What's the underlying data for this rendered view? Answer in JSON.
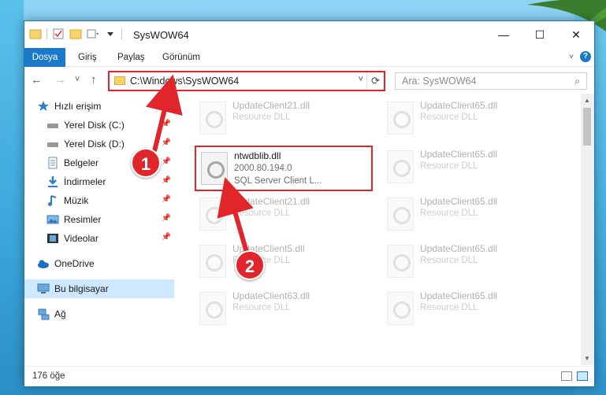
{
  "window": {
    "title": "SysWOW64",
    "controls": {
      "minimize": "—",
      "maximize": "☐",
      "close": "✕"
    }
  },
  "ribbon": {
    "tabs": [
      "Dosya",
      "Giriş",
      "Paylaş",
      "Görünüm"
    ]
  },
  "nav": {
    "back": "←",
    "forward": "→",
    "recent": "˅",
    "up": "↑"
  },
  "address": {
    "path": "C:\\Windows\\SysWOW64"
  },
  "search": {
    "placeholder": "Ara: SysWOW64"
  },
  "sidebar": {
    "items": [
      {
        "label": "Hızlı erişim"
      },
      {
        "label": "Yerel Disk (C:)"
      },
      {
        "label": "Yerel Disk (D:)"
      },
      {
        "label": "Belgeler"
      },
      {
        "label": "İndirmeler"
      },
      {
        "label": "Müzik"
      },
      {
        "label": "Resimler"
      },
      {
        "label": "Videolar"
      },
      {
        "label": "OneDrive"
      },
      {
        "label": "Bu bilgisayar"
      },
      {
        "label": "Ağ"
      }
    ]
  },
  "files": {
    "highlighted": {
      "name": "ntwdblib.dll",
      "version": "2000.80.194.0",
      "description": "SQL Server Client L..."
    },
    "others": [
      {
        "name": "UpdateClient21.dll",
        "type": "Resource DLL"
      },
      {
        "name": "UpdateClient65.dll",
        "type": "Resource DLL"
      },
      {
        "name": "UpdateClient65.dll",
        "type": "Resource DLL"
      },
      {
        "name": "UpdateClient21.dll",
        "type": "Resource DLL"
      },
      {
        "name": "UpdateClient65.dll",
        "type": "Resource DLL"
      },
      {
        "name": "UpdateClient5.dll",
        "type": "Resource DLL"
      },
      {
        "name": "UpdateClient65.dll",
        "type": "Resource DLL"
      },
      {
        "name": "UpdateClient63.dll",
        "type": "Resource DLL"
      },
      {
        "name": "UpdateClient65.dll",
        "type": "Resource DLL"
      }
    ]
  },
  "status": {
    "count": "176 öğe"
  },
  "annotations": {
    "step1": "1",
    "step2": "2"
  },
  "colors": {
    "accent": "#1979ca",
    "highlight": "#e0262b"
  }
}
